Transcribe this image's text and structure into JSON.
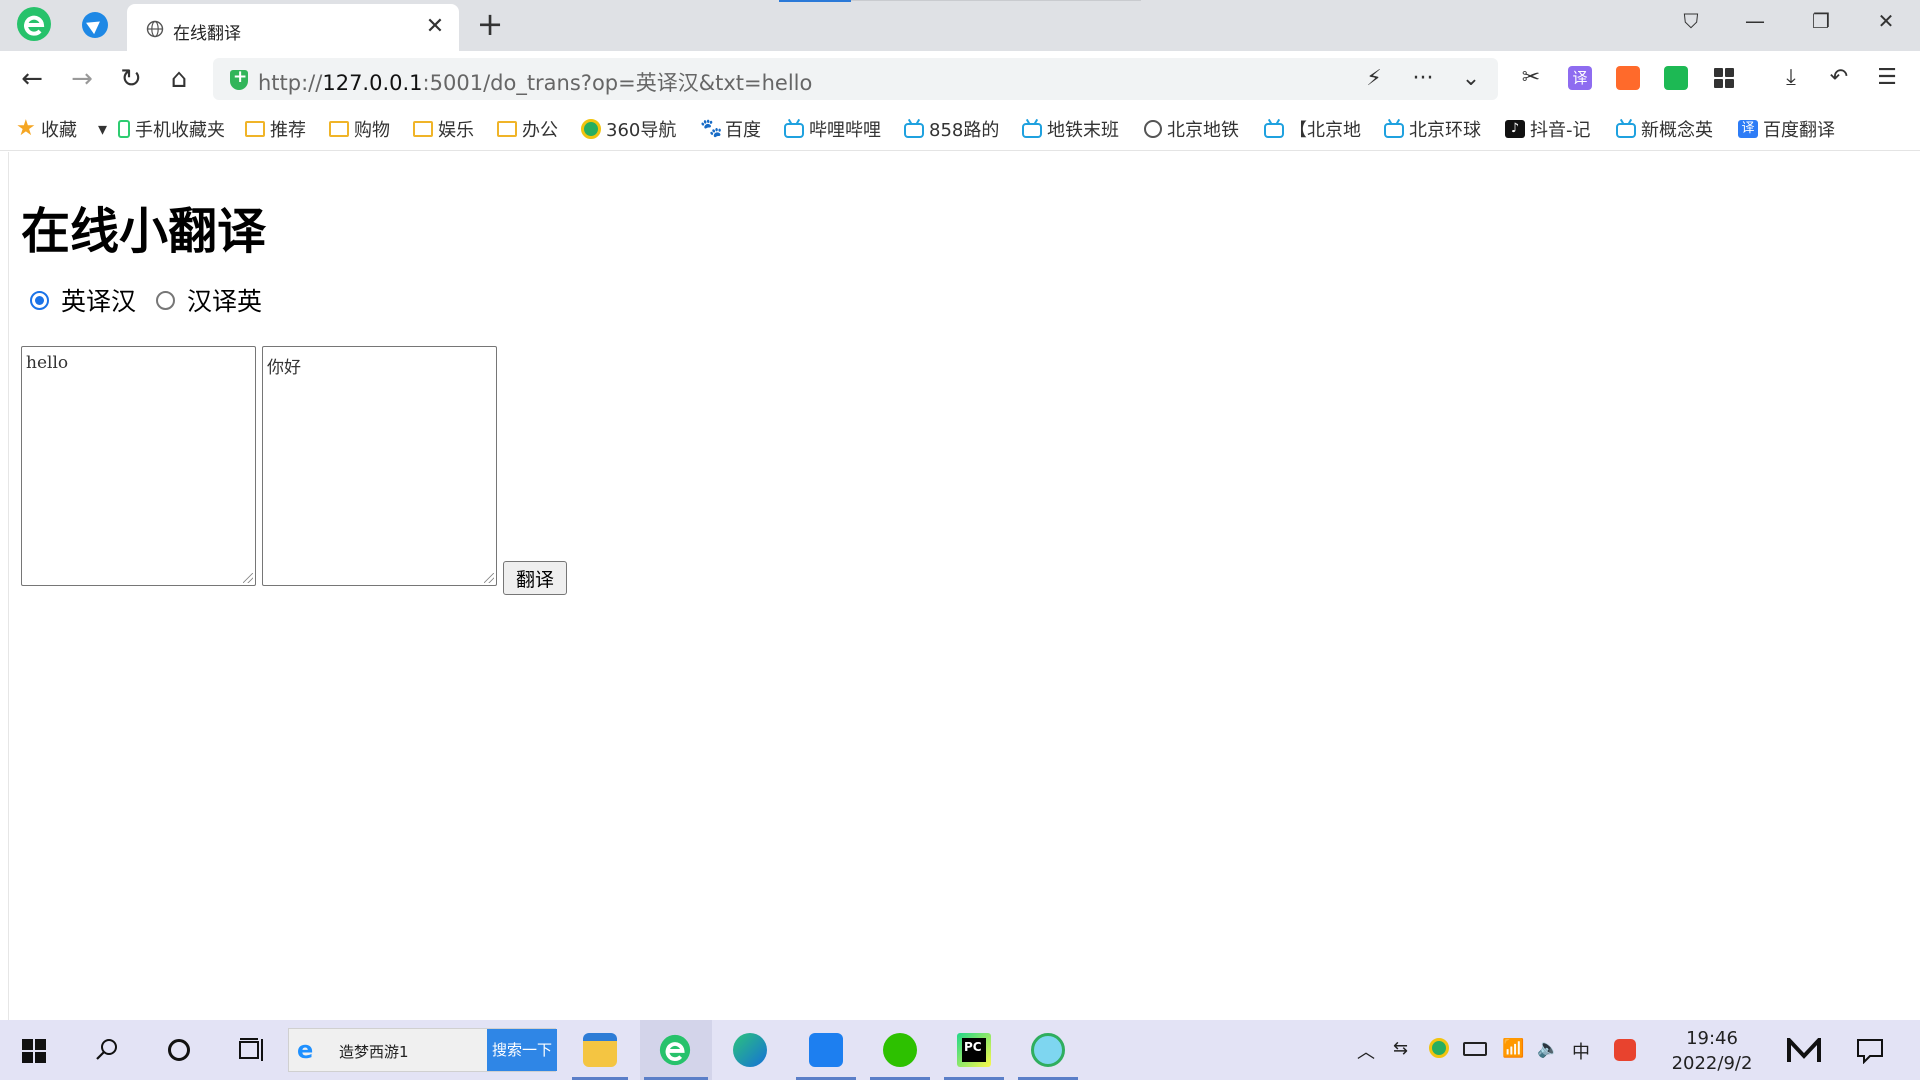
{
  "tab": {
    "title": "在线翻译",
    "close": "✕",
    "new": "+"
  },
  "window": {
    "shirt": "⛉",
    "min": "—",
    "restore": "❐",
    "close": "✕"
  },
  "nav": {
    "back": "←",
    "forward": "→",
    "reload": "↻",
    "home": "⌂",
    "url_scheme": "http://",
    "url_host": "127.0.0.1",
    "url_rest": ":5001/do_trans?op=英译汉&txt=hello",
    "lightning": "⚡",
    "more": "···",
    "dropdown": "⌄",
    "cut": "✂",
    "translate_ext": "译",
    "download": "⤓",
    "undo": "↶",
    "menu": "☰"
  },
  "bookmarks": [
    {
      "label": "收藏",
      "icon": "star-icon"
    },
    {
      "label": "手机收藏夹",
      "icon": "phone-icon"
    },
    {
      "label": "推荐",
      "icon": "folder-icon"
    },
    {
      "label": "购物",
      "icon": "folder-icon"
    },
    {
      "label": "娱乐",
      "icon": "folder-icon"
    },
    {
      "label": "办公",
      "icon": "folder-icon"
    },
    {
      "label": "360导航",
      "icon": "360-icon"
    },
    {
      "label": "百度",
      "icon": "paw-icon"
    },
    {
      "label": "哔哩哔哩",
      "icon": "tv-icon"
    },
    {
      "label": "858路的",
      "icon": "tv-icon"
    },
    {
      "label": "地铁末班",
      "icon": "tv-icon"
    },
    {
      "label": "北京地铁",
      "icon": "globe-icon"
    },
    {
      "label": "【北京地",
      "icon": "tv-icon"
    },
    {
      "label": "北京环球",
      "icon": "tv-icon"
    },
    {
      "label": "抖音-记",
      "icon": "tiktok-icon"
    },
    {
      "label": "新概念英",
      "icon": "tv-icon"
    },
    {
      "label": "百度翻译",
      "icon": "translate-icon"
    }
  ],
  "page": {
    "title": "在线小翻译",
    "radio_en2zh": "英译汉",
    "radio_zh2en": "汉译英",
    "input_text": "hello",
    "output_text": "你好",
    "button": "翻译"
  },
  "taskbar": {
    "search_text": "造梦西游1",
    "search_button": "搜索一下",
    "ime": "中",
    "time": "19:46",
    "date": "2022/9/2"
  }
}
